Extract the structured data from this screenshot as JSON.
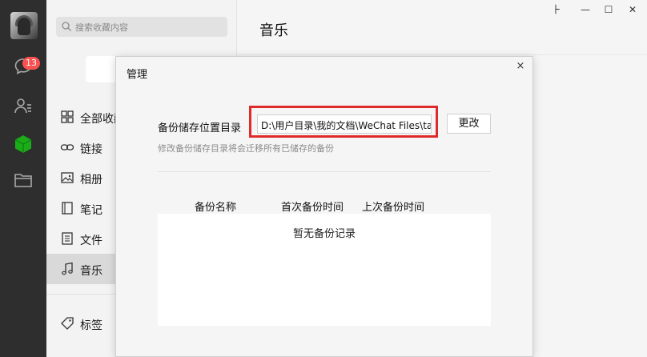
{
  "rail": {
    "unread_badge": "13"
  },
  "sidebar": {
    "search_placeholder": "搜索收藏内容",
    "new_button_label": "+",
    "items": [
      {
        "label": "全部收藏",
        "icon": "grid-icon"
      },
      {
        "label": "链接",
        "icon": "link-icon"
      },
      {
        "label": "相册",
        "icon": "image-icon"
      },
      {
        "label": "笔记",
        "icon": "note-icon"
      },
      {
        "label": "文件",
        "icon": "file-icon"
      },
      {
        "label": "音乐",
        "icon": "music-icon",
        "active": true
      },
      {
        "label": "标签",
        "icon": "tag-icon"
      }
    ]
  },
  "main": {
    "title": "音乐"
  },
  "window_controls": {
    "pin": "⺊",
    "minimize": "—",
    "maximize": "☐",
    "close": "✕"
  },
  "modal": {
    "title": "管理",
    "close": "×",
    "path_label": "备份储存位置目录",
    "path_value": "D:\\用户目录\\我的文档\\WeChat Files\\tai",
    "change_button": "更改",
    "hint": "修改备份储存目录将会迁移所有已储存的备份",
    "columns": [
      "备份名称",
      "首次备份时间",
      "上次备份时间"
    ],
    "empty_text": "暂无备份记录"
  },
  "colors": {
    "rail_bg": "#2e2e2e",
    "badge": "#fa5151",
    "highlight_outline": "#e02a2a",
    "accent_green": "#1aad19"
  }
}
